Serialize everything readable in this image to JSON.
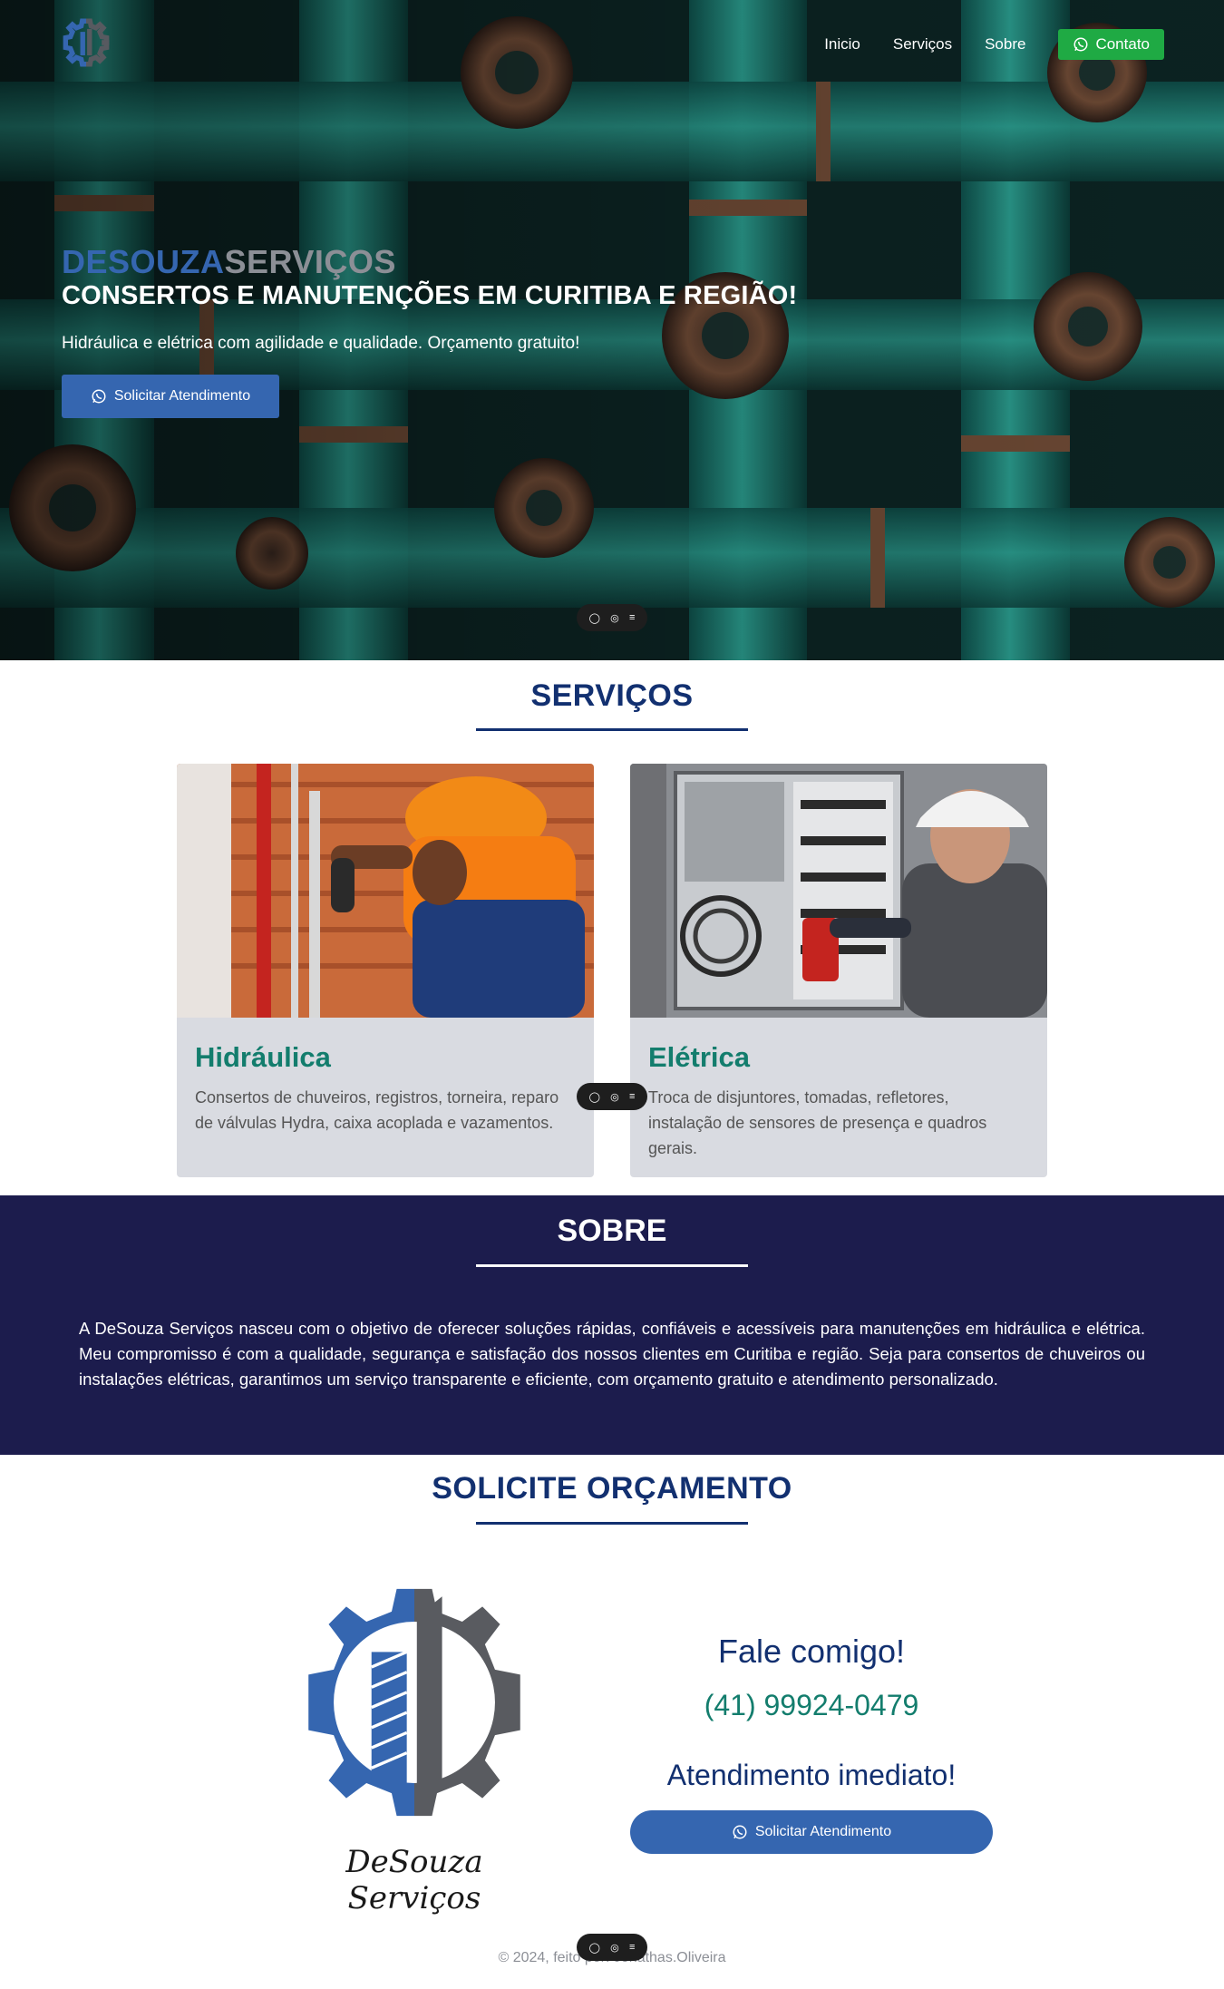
{
  "nav": {
    "logo_icon": "gear-logo-icon",
    "items": [
      "Inicio",
      "Serviços",
      "Sobre"
    ],
    "contact_label": "Contato"
  },
  "hero": {
    "brand_part1": "DESOUZA",
    "brand_part2": "SERVIÇOS",
    "title": "CONSERTOS E MANUTENÇÕES EM CURITIBA E REGIÃO!",
    "subtitle": "Hidráulica e elétrica com agilidade e qualidade. Orçamento gratuito!",
    "cta_label": "Solicitar Atendimento",
    "background": "pipes-photo"
  },
  "services": {
    "title": "SERVIÇOS",
    "cards": [
      {
        "title": "Hidráulica",
        "text": "Consertos de chuveiros, registros, torneira, reparo de válvulas Hydra, caixa acoplada e vazamentos.",
        "photo": "plumber-photo"
      },
      {
        "title": "Elétrica",
        "text": "Troca de disjuntores, tomadas, refletores, instalação de sensores de presença e quadros gerais.",
        "photo": "electrician-photo"
      }
    ]
  },
  "about": {
    "title": "SOBRE",
    "text": "A DeSouza Serviços nasceu com o objetivo de oferecer soluções rápidas, confiáveis e acessíveis para manutenções em hidráulica e elétrica. Meu compromisso é com a qualidade, segurança e satisfação dos nossos clientes em Curitiba e região. Seja para consertos de chuveiros ou instalações elétricas, garantimos um serviço transparente e eficiente, com orçamento gratuito e atendimento personalizado."
  },
  "quote": {
    "title": "SOLICITE ORÇAMENTO",
    "logo_text": "DeSouza Serviços",
    "heading": "Fale comigo!",
    "phone": "(41) 99924-0479",
    "subheading": "Atendimento imediato!",
    "cta_label": "Solicitar Atendimento"
  },
  "footer": {
    "text": "© 2024, feito por: Jonathas.Oliveira"
  },
  "colors": {
    "brand_blue": "#3566b0",
    "navy": "#123070",
    "teal": "#137d6d",
    "about_bg": "#1c1c4d",
    "whatsapp_green": "#1faa44",
    "gray": "#8c8f96"
  }
}
